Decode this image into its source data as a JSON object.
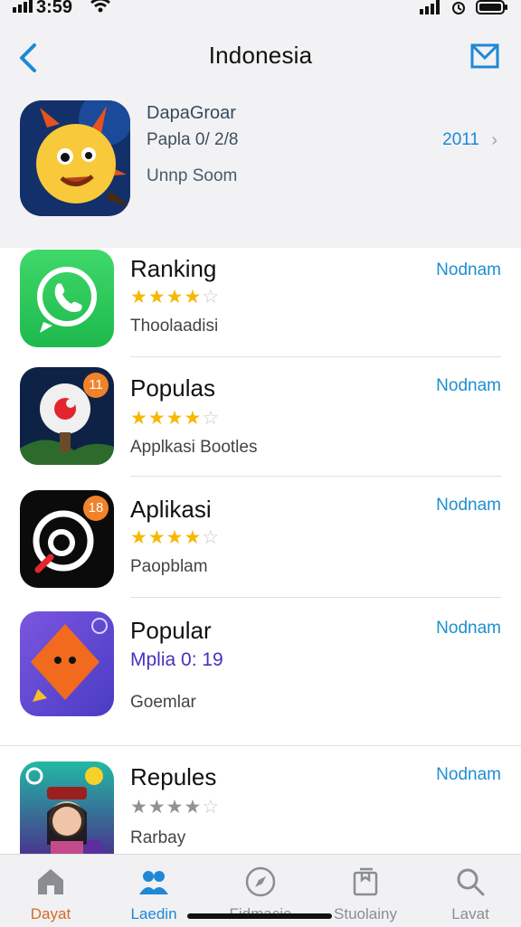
{
  "status": {
    "time": "3:59"
  },
  "nav": {
    "title": "Indonesia"
  },
  "featured": {
    "name": "DapaGroar",
    "subtitle": "Papla 0/ 2/8",
    "category": "Unnp Soom",
    "count": "2011"
  },
  "apps": [
    {
      "name": "Ranking",
      "rating": 4,
      "rating_text": "",
      "subtitle": "Thoolaadisi",
      "action": "Nodnam",
      "icon": "whatsapp-icon"
    },
    {
      "name": "Populas",
      "rating": 4,
      "rating_text": "",
      "subtitle": "Applkasi Bootles",
      "action": "Nodnam",
      "badge": "11",
      "icon": "red-bubble-icon"
    },
    {
      "name": "Aplikasi",
      "rating": 4,
      "rating_text": "",
      "subtitle": "Paopblam",
      "action": "Nodnam",
      "badge": "18",
      "icon": "black-swirl-icon"
    },
    {
      "name": "Popular",
      "rating": 0,
      "rating_text": "Mplia 0: 19",
      "subtitle": "Goemlar",
      "action": "Nodnam",
      "icon": "orange-diamond-icon"
    },
    {
      "name": "Repules",
      "rating": 4,
      "rating_text": "",
      "subtitle": "Rarbay",
      "action": "Nodnam",
      "icon": "portrait-icon"
    }
  ],
  "tabs": [
    {
      "label": "Dayat",
      "icon": "home-icon"
    },
    {
      "label": "Laedin",
      "icon": "people-icon"
    },
    {
      "label": "Fidmacie",
      "icon": "compass-icon"
    },
    {
      "label": "Stuolainy",
      "icon": "stack-icon"
    },
    {
      "label": "Lavat",
      "icon": "search-icon"
    }
  ],
  "colors": {
    "accent": "#1e88d6",
    "star": "#f6b800",
    "active_tab": "#d66a24"
  }
}
